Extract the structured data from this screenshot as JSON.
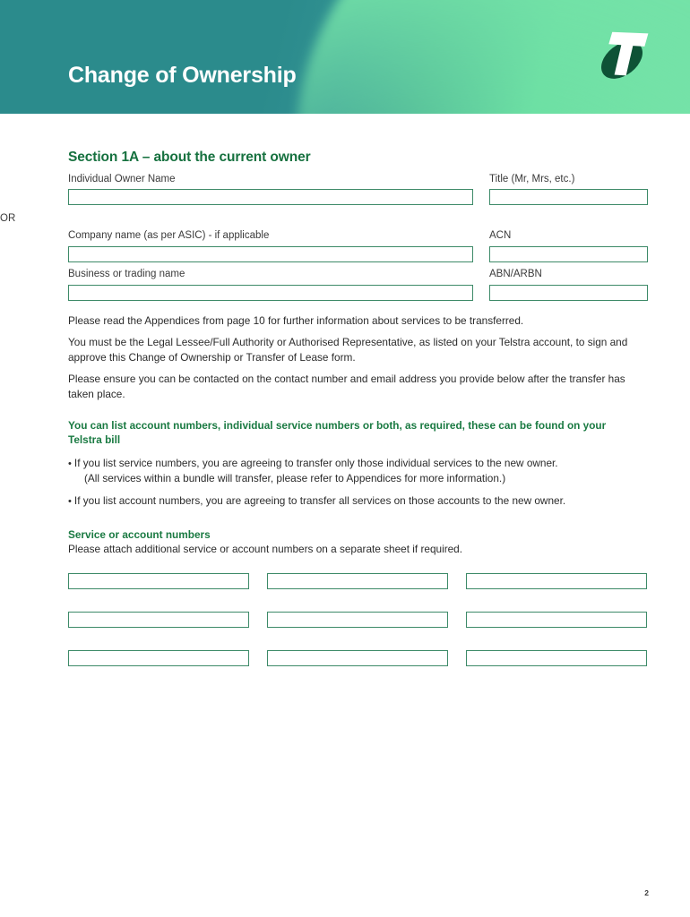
{
  "header": {
    "title": "Change of Ownership",
    "logo_name": "telstra-logo",
    "gradient_from": "#2b8b8c",
    "gradient_to": "#74e2a6"
  },
  "section": {
    "heading": "Section 1A – about the current owner",
    "heading_color": "#16713f"
  },
  "form": {
    "or_label": "OR",
    "rows": [
      {
        "left_label": "Individual Owner Name",
        "left_value": "",
        "left_name": "individual-owner-name",
        "right_label": "Title (Mr, Mrs, etc.)",
        "right_value": "",
        "right_name": "title"
      },
      {
        "left_label": "Company name (as per ASIC) - if applicable",
        "left_value": "",
        "left_name": "company-name",
        "right_label": "ACN",
        "right_value": "",
        "right_name": "acn"
      },
      {
        "left_label": "Business or trading name",
        "left_value": "",
        "left_name": "business-trading-name",
        "right_label": "ABN/ARBN",
        "right_value": "",
        "right_name": "abn-arbn"
      }
    ]
  },
  "paragraphs": [
    "Please read the Appendices from page 10 for further information about services to be transferred.",
    "You must be the Legal Lessee/Full Authority or Authorised Representative, as listed on your Telstra account, to sign and approve this Change of Ownership or Transfer of Lease form.",
    "Please ensure you can be contacted on the contact number and email address you provide below after the transfer has taken place."
  ],
  "notice": {
    "text": "You can list account numbers, individual service numbers or both, as required, these can be found on your Telstra bill",
    "color": "#1a7a42"
  },
  "bullets": [
    {
      "main": "If you list service numbers, you are agreeing to transfer only those individual services to the new owner.",
      "sub": "(All services within a bundle will transfer, please refer to Appendices for more information.)"
    },
    {
      "main": "If you list account numbers, you are agreeing to transfer all services on those accounts to the new owner.",
      "sub": ""
    }
  ],
  "service_numbers": {
    "heading": "Service or account numbers",
    "note": "Please attach additional service or account numbers on a separate sheet if required.",
    "boxes": [
      {
        "value": "",
        "name": "service-number-1"
      },
      {
        "value": "",
        "name": "service-number-2"
      },
      {
        "value": "",
        "name": "service-number-3"
      },
      {
        "value": "",
        "name": "service-number-4"
      },
      {
        "value": "",
        "name": "service-number-5"
      },
      {
        "value": "",
        "name": "service-number-6"
      },
      {
        "value": "",
        "name": "service-number-7"
      },
      {
        "value": "",
        "name": "service-number-8"
      },
      {
        "value": "",
        "name": "service-number-9"
      }
    ]
  },
  "footer": {
    "page_number": "2"
  },
  "colors": {
    "field_border": "#3d8a68",
    "body_text": "#2b2b2b"
  }
}
